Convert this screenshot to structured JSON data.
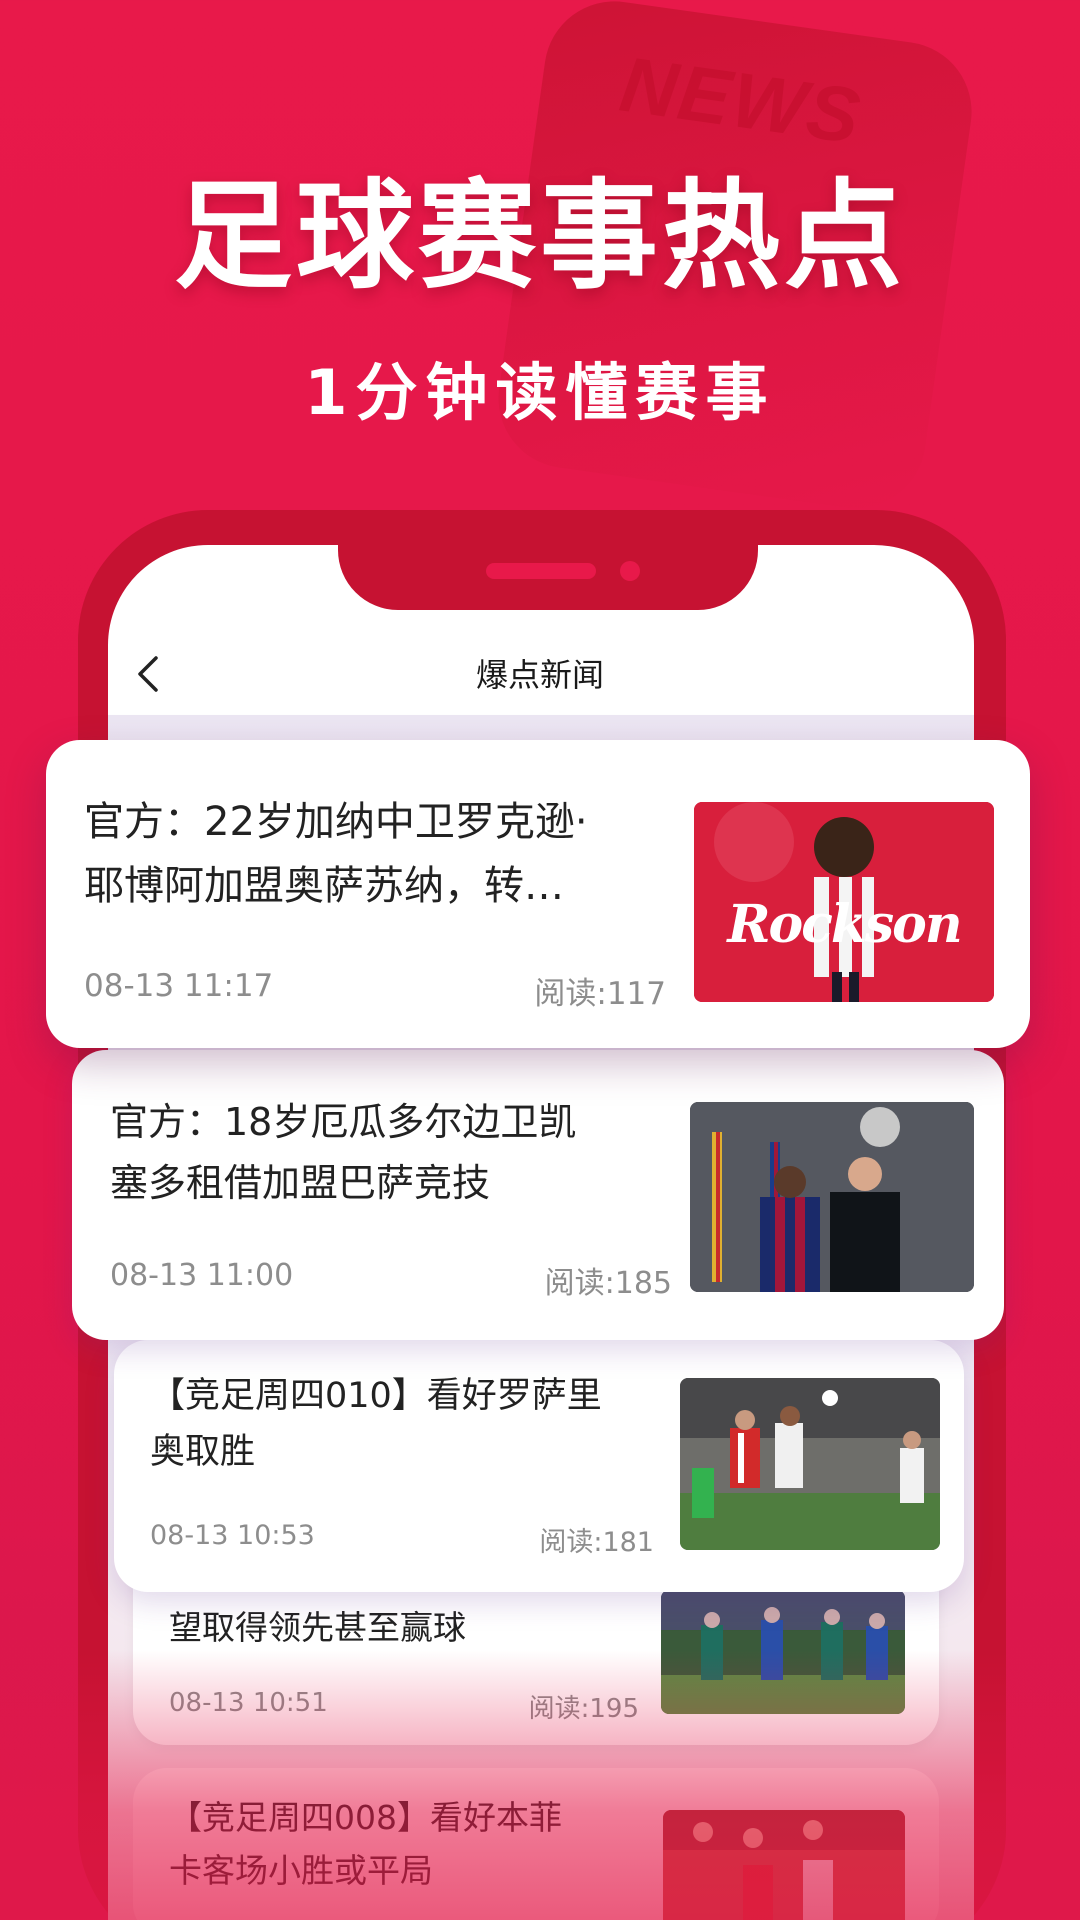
{
  "hero": {
    "logo_text": "NEWS",
    "title": "足球赛事热点",
    "subtitle": "1分钟读懂赛事"
  },
  "header": {
    "back_icon": "chevron-left-icon",
    "title": "爆点新闻"
  },
  "news": [
    {
      "title_line1": "官方：22岁加纳中卫罗克逊·",
      "title_line2": "耶博阿加盟奥萨苏纳，转…",
      "date": "08-13 11:17",
      "reads": "阅读:117",
      "thumb_text": "Rockson"
    },
    {
      "title_line1": "官方：18岁厄瓜多尔边卫凯",
      "title_line2": "塞多租借加盟巴萨竞技",
      "date": "08-13 11:00",
      "reads": "阅读:185"
    },
    {
      "title_line1": "【竞足周四010】看好罗萨里",
      "title_line2": "奥取胜",
      "date": "08-13 10:53",
      "reads": "阅读:181"
    },
    {
      "title_line2": "望取得领先甚至赢球",
      "date": "08-13 10:51",
      "reads": "阅读:195"
    },
    {
      "title_line1": "【竞足周四008】看好本菲",
      "title_line2": "卡客场小胜或平局"
    }
  ],
  "colors": {
    "background": "#e8194a",
    "frame": "#c61232",
    "card": "#ffffff",
    "meta_text": "#8d8d8d"
  }
}
